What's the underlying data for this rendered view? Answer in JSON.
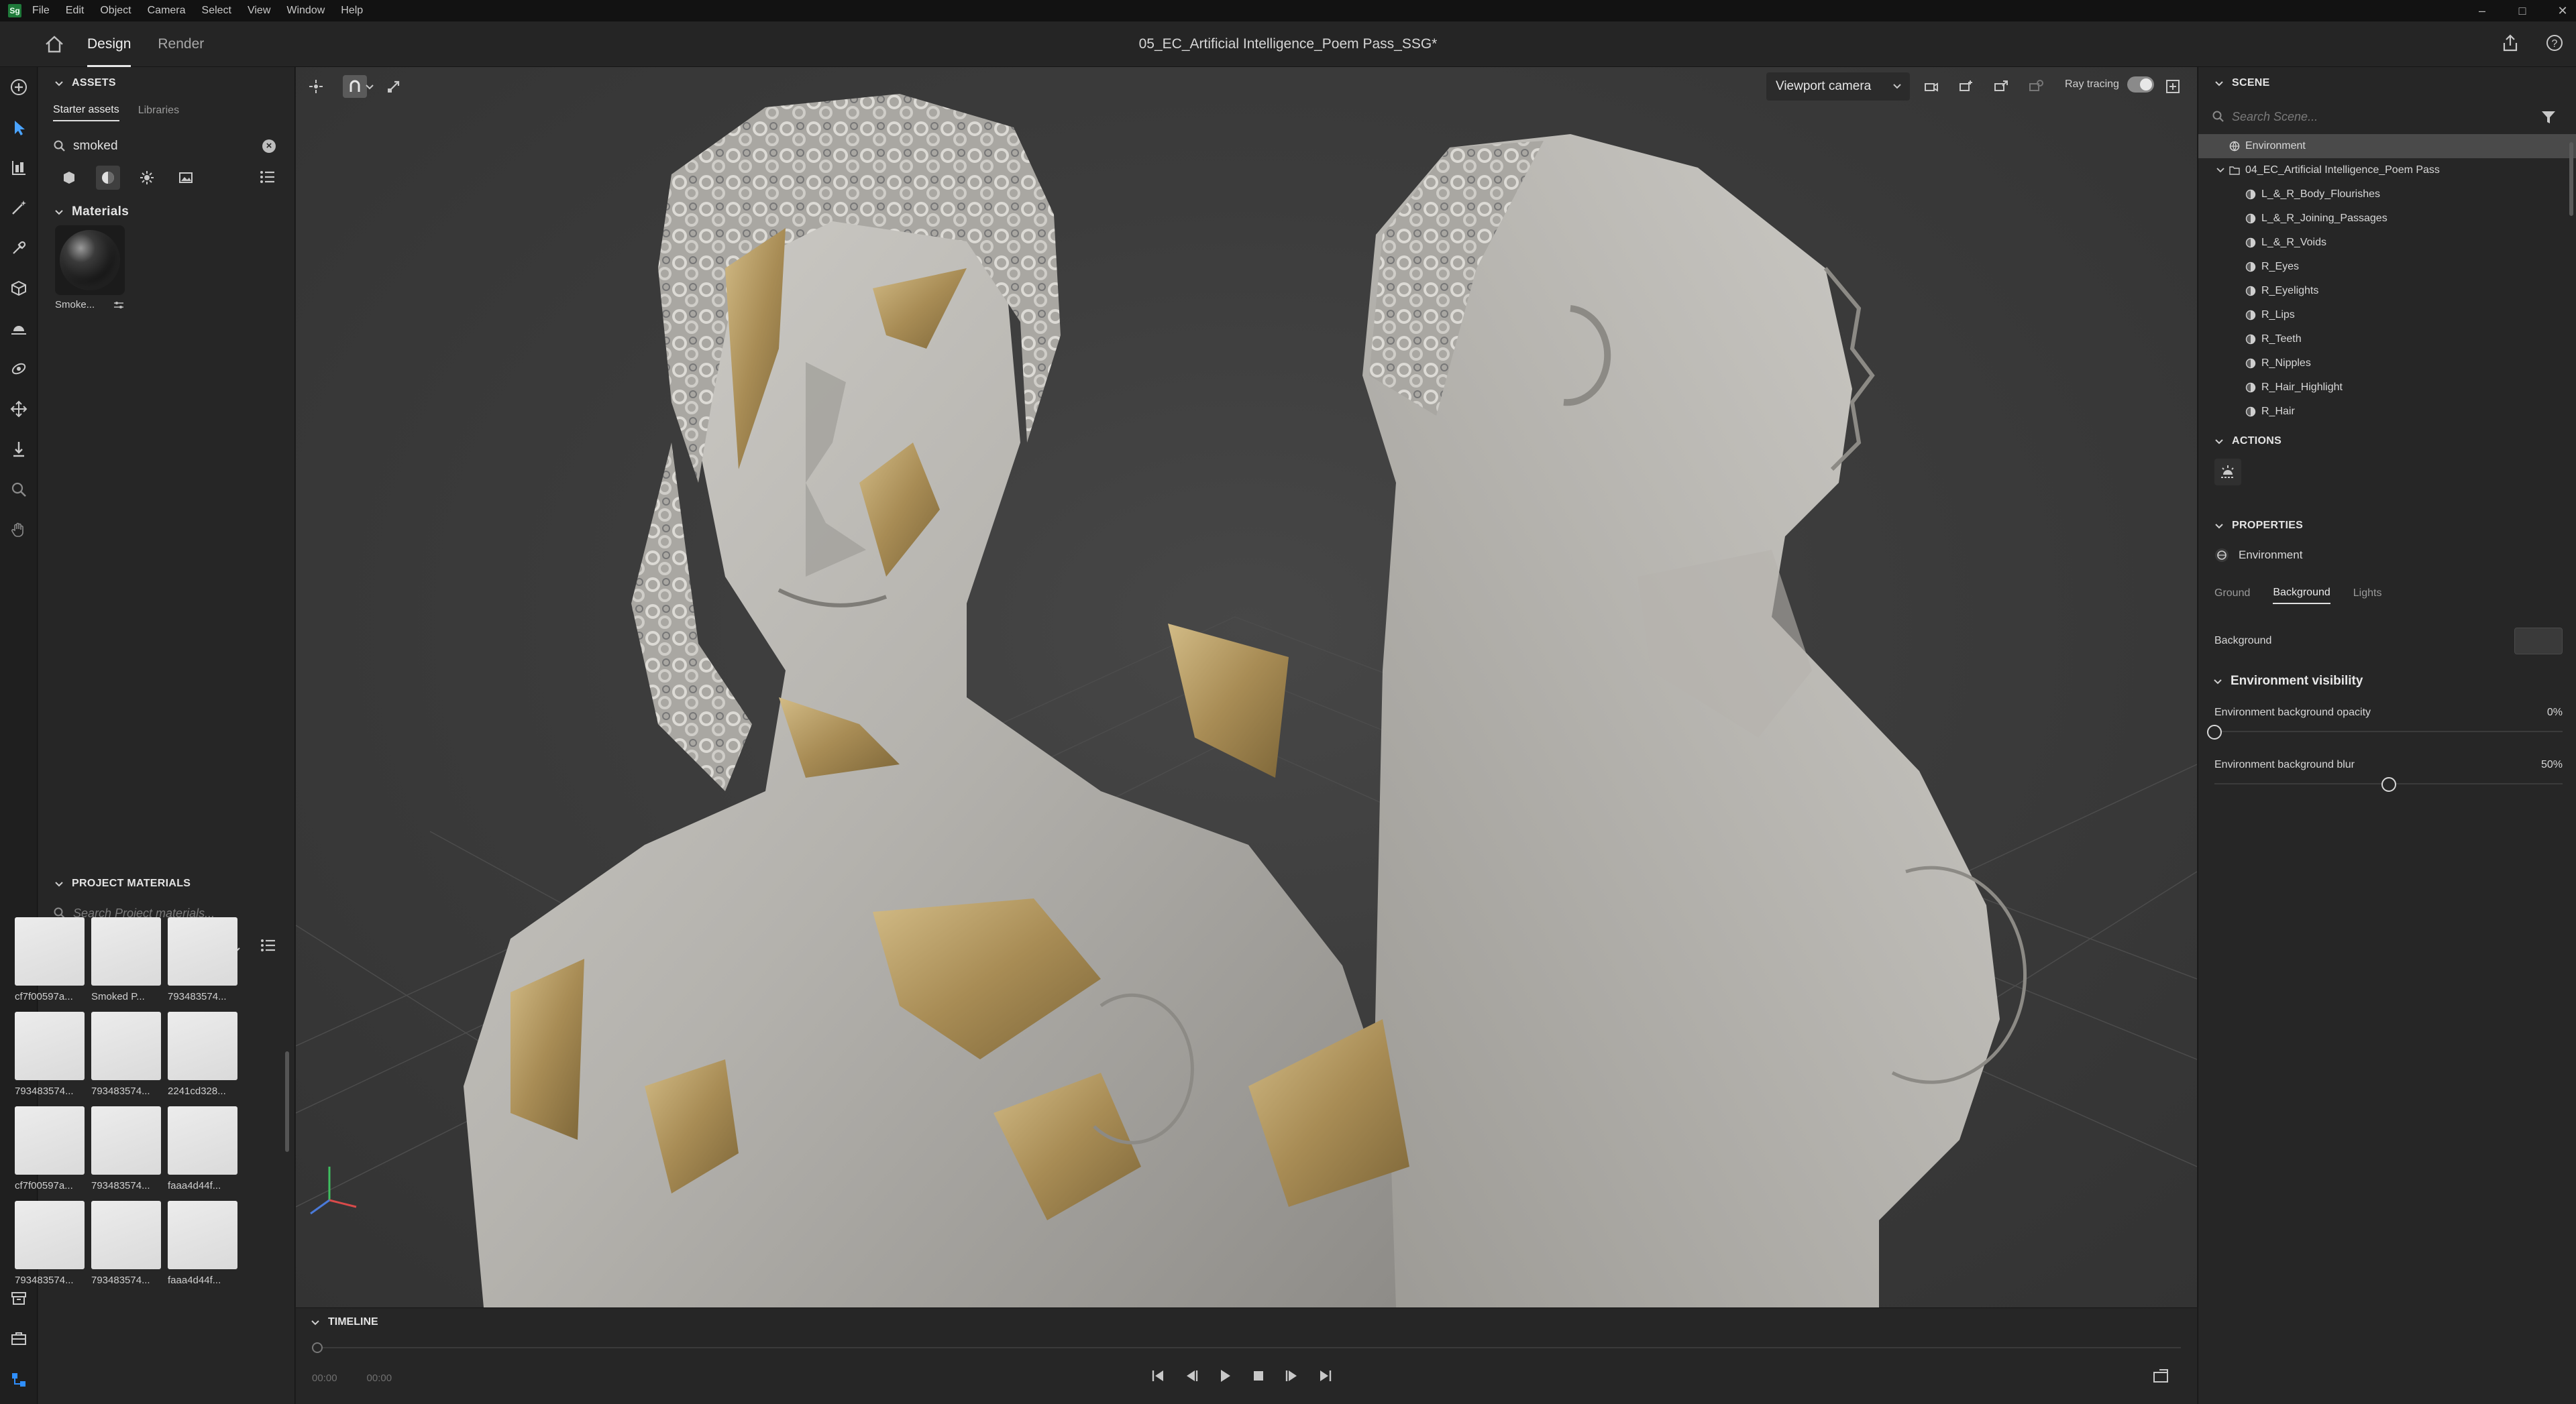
{
  "menubar": {
    "logo": "Sg",
    "items": [
      "File",
      "Edit",
      "Object",
      "Camera",
      "Select",
      "View",
      "Window",
      "Help"
    ]
  },
  "header": {
    "tabs": [
      "Design",
      "Render"
    ],
    "active_tab": "Design",
    "document_title": "05_EC_Artificial Intelligence_Poem Pass_SSG*"
  },
  "assets": {
    "heading": "ASSETS",
    "tabs": [
      "Starter assets",
      "Libraries"
    ],
    "search_value": "smoked",
    "materials_heading": "Materials",
    "materials": [
      {
        "label": "Smoke..."
      }
    ]
  },
  "project_materials": {
    "heading": "PROJECT MATERIALS",
    "search_placeholder": "Search Project materials...",
    "items": [
      "cf7f00597a...",
      "Smoked P...",
      "793483574...",
      "793483574...",
      "793483574...",
      "2241cd328...",
      "cf7f00597a...",
      "793483574...",
      "faaa4d44f...",
      "793483574...",
      "793483574...",
      "faaa4d44f..."
    ]
  },
  "viewport": {
    "camera": "Viewport camera",
    "ray_tracing_label": "Ray tracing",
    "ray_tracing_on": true
  },
  "timeline": {
    "heading": "TIMELINE",
    "current_time": "00:00",
    "end_time": "00:00"
  },
  "scene": {
    "heading": "SCENE",
    "search_placeholder": "Search Scene...",
    "environment": "Environment",
    "group": "04_EC_Artificial Intelligence_Poem Pass",
    "children": [
      "L_&_R_Body_Flourishes",
      "L_&_R_Joining_Passages",
      "L_&_R_Voids",
      "R_Eyes",
      "R_Eyelights",
      "R_Lips",
      "R_Teeth",
      "R_Nipples",
      "R_Hair_Highlight",
      "R_Hair"
    ]
  },
  "actions": {
    "heading": "ACTIONS"
  },
  "properties": {
    "heading": "PROPERTIES",
    "object": "Environment",
    "tabs": [
      "Ground",
      "Background",
      "Lights"
    ],
    "active_tab": "Background",
    "background_label": "Background",
    "visibility_heading": "Environment visibility",
    "opacity_label": "Environment background opacity",
    "opacity_value": "0%",
    "opacity": 0,
    "blur_label": "Environment background blur",
    "blur_value": "50%",
    "blur": 0.5
  },
  "colors": {
    "accent_gold": "#b59a63",
    "statue_grey": "#b9b7b2",
    "panel": "#262626"
  }
}
